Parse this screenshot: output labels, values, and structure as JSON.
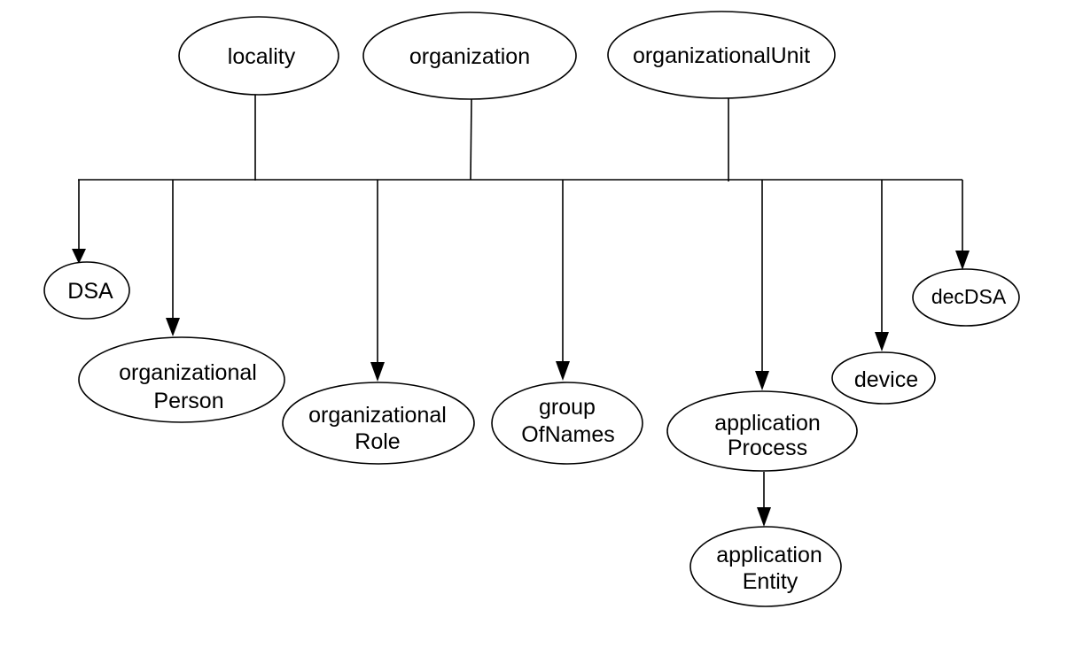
{
  "diagram": {
    "title": "",
    "nodes": {
      "locality": {
        "lines": [
          "locality"
        ]
      },
      "organization": {
        "lines": [
          "organization"
        ]
      },
      "organizationalUnit": {
        "lines": [
          "organizationalUnit"
        ]
      },
      "DSA": {
        "lines": [
          "DSA"
        ]
      },
      "organizationalPerson": {
        "lines": [
          "organizational",
          "Person"
        ]
      },
      "organizationalRole": {
        "lines": [
          "organizational",
          "Role"
        ]
      },
      "groupOfNames": {
        "lines": [
          "group",
          "OfNames"
        ]
      },
      "applicationProcess": {
        "lines": [
          "application",
          "Process"
        ]
      },
      "device": {
        "lines": [
          "device"
        ]
      },
      "decDSA": {
        "lines": [
          "decDSA"
        ]
      },
      "applicationEntity": {
        "lines": [
          "application",
          "Entity"
        ]
      }
    },
    "superiors": [
      "locality",
      "organization",
      "organizationalUnit"
    ],
    "subordinates": [
      "DSA",
      "organizationalPerson",
      "organizationalRole",
      "groupOfNames",
      "applicationProcess",
      "device",
      "decDSA"
    ],
    "edges": [
      {
        "from": "applicationProcess",
        "to": "applicationEntity"
      }
    ]
  }
}
